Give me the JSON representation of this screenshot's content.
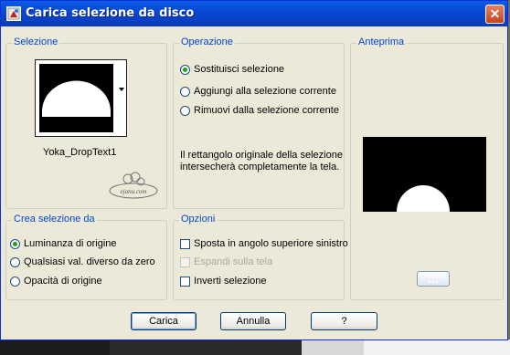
{
  "window": {
    "title": "Carica selezione da disco",
    "close_glyph": "✕"
  },
  "selezione": {
    "label": "Selezione",
    "thumbnail_name": "Yoka_DropText1",
    "watermark_text": "ejanu.com"
  },
  "operazione": {
    "label": "Operazione",
    "options": [
      {
        "label": "Sostituisci selezione",
        "selected": true
      },
      {
        "label": "Aggiungi alla selezione corrente",
        "selected": false
      },
      {
        "label": "Rimuovi dalla selezione corrente",
        "selected": false
      }
    ],
    "info": "Il rettangolo originale della selezione intersecherà completamente la tela."
  },
  "anteprima": {
    "label": "Anteprima"
  },
  "crea": {
    "label": "Crea selezione da",
    "options": [
      {
        "label": "Luminanza di origine",
        "selected": true
      },
      {
        "label": "Qualsiasi val. diverso da zero",
        "selected": false
      },
      {
        "label": "Opacità di origine",
        "selected": false
      }
    ]
  },
  "opzioni": {
    "label": "Opzioni",
    "checks": [
      {
        "label": "Sposta in angolo superiore sinistro",
        "checked": false,
        "enabled": true
      },
      {
        "label": "Espandi sulla tela",
        "checked": false,
        "enabled": false
      },
      {
        "label": "Inverti selezione",
        "checked": false,
        "enabled": true
      }
    ]
  },
  "buttons": {
    "ok": "Carica",
    "cancel": "Annulla",
    "help": "?"
  },
  "colors": {
    "titlebar": "#0a5ce6",
    "group_label": "#0046d5",
    "dialog_bg": "#ece9d8"
  }
}
